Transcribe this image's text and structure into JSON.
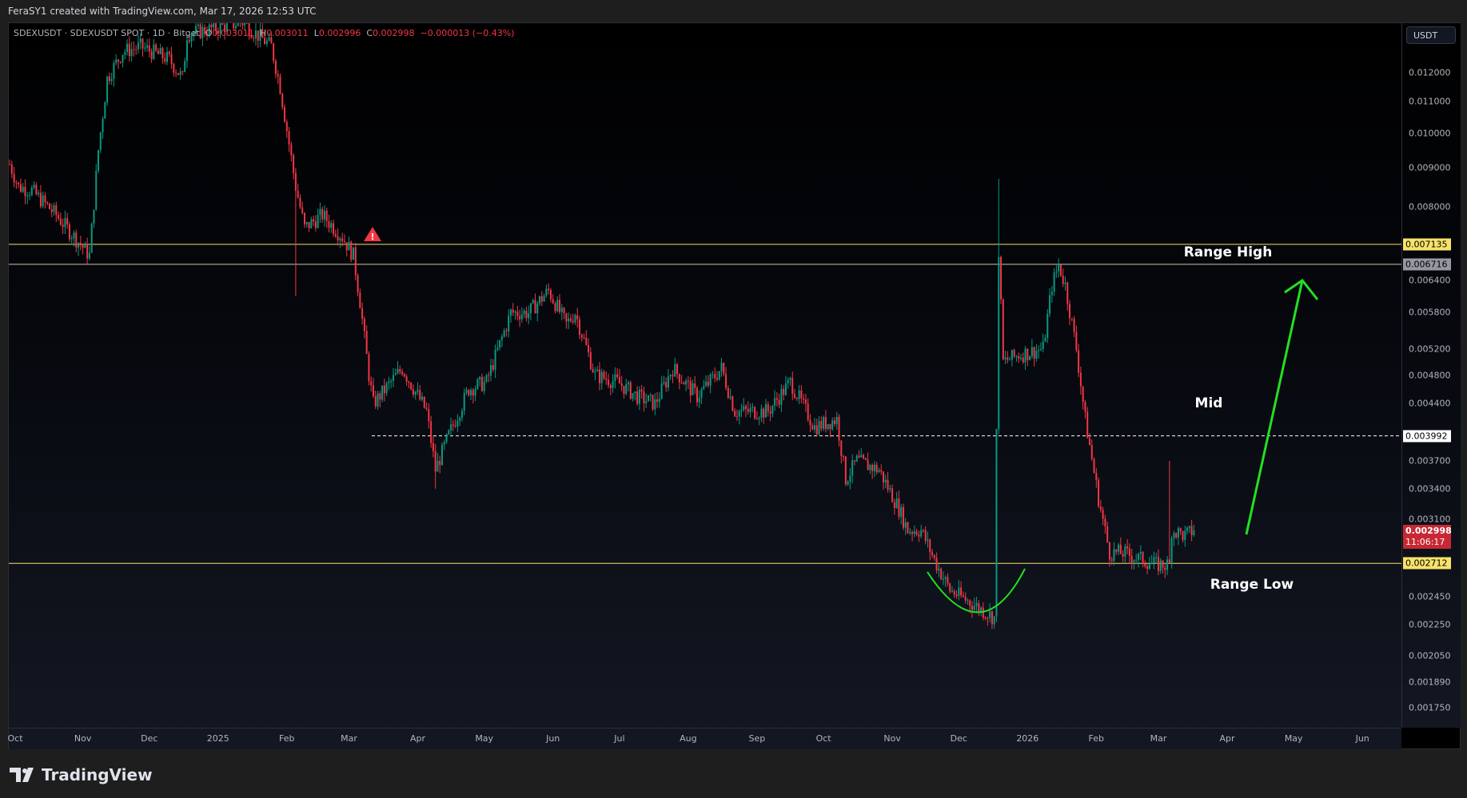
{
  "header": {
    "caption": "FeraSY1 created with TradingView.com, Mar 17, 2026 12:53 UTC"
  },
  "legend": {
    "symbol": "SDEXUSDT · SDEXUSDT SPOT · 1D · Bitget",
    "open_label": "O",
    "open": "0.003011",
    "high_label": "H",
    "high": "0.003011",
    "low_label": "L",
    "low": "0.002996",
    "close_label": "C",
    "close": "0.002998",
    "change": "−0.000013 (−0.43%)"
  },
  "price_axis": {
    "currency": "USDT",
    "ticks": [
      "0.012000",
      "0.011000",
      "0.010000",
      "0.009000",
      "0.008000",
      "0.006400",
      "0.005800",
      "0.005200",
      "0.004800",
      "0.004400",
      "0.003700",
      "0.003400",
      "0.003100",
      "0.002450",
      "0.002250",
      "0.002050",
      "0.001890",
      "0.001750"
    ],
    "labels": {
      "range_high": "0.007135",
      "upper_line": "0.006716",
      "mid": "0.003992",
      "last_price": "0.002998",
      "countdown": "11:06:17",
      "range_low": "0.002712"
    }
  },
  "time_axis": {
    "ticks": [
      {
        "label": "Oct",
        "day": 0
      },
      {
        "label": "Nov",
        "day": 31
      },
      {
        "label": "Dec",
        "day": 61
      },
      {
        "label": "2025",
        "day": 92
      },
      {
        "label": "Feb",
        "day": 123
      },
      {
        "label": "Mar",
        "day": 151
      },
      {
        "label": "Apr",
        "day": 182
      },
      {
        "label": "May",
        "day": 212
      },
      {
        "label": "Jun",
        "day": 243
      },
      {
        "label": "Jul",
        "day": 273
      },
      {
        "label": "Aug",
        "day": 304
      },
      {
        "label": "Sep",
        "day": 335
      },
      {
        "label": "Oct",
        "day": 365
      },
      {
        "label": "Nov",
        "day": 396
      },
      {
        "label": "Dec",
        "day": 426
      },
      {
        "label": "2026",
        "day": 457
      },
      {
        "label": "Feb",
        "day": 488
      },
      {
        "label": "Mar",
        "day": 516
      },
      {
        "label": "Apr",
        "day": 547
      },
      {
        "label": "May",
        "day": 577
      },
      {
        "label": "Jun",
        "day": 608
      }
    ]
  },
  "annotations": {
    "range_high": "Range High",
    "mid": "Mid",
    "range_low": "Range Low"
  },
  "colors": {
    "up": "#089981",
    "down": "#f23645",
    "level": "#f7e26b",
    "arrow": "#22e022"
  },
  "chart_data": {
    "type": "candlestick",
    "scale": "log",
    "start_date": "2024-10-01",
    "close_keypoints": [
      [
        -2,
        0.0091
      ],
      [
        2,
        0.0085
      ],
      [
        8,
        0.0084
      ],
      [
        19,
        0.0078
      ],
      [
        34,
        0.0069
      ],
      [
        38,
        0.0095
      ],
      [
        42,
        0.0118
      ],
      [
        49,
        0.0128
      ],
      [
        57,
        0.013
      ],
      [
        70,
        0.0125
      ],
      [
        76,
        0.0118
      ],
      [
        78,
        0.0135
      ],
      [
        103,
        0.014
      ],
      [
        116,
        0.013
      ],
      [
        120,
        0.0115
      ],
      [
        127,
        0.0085
      ],
      [
        131,
        0.0075
      ],
      [
        139,
        0.0078
      ],
      [
        148,
        0.0073
      ],
      [
        153,
        0.0069
      ],
      [
        156,
        0.006
      ],
      [
        160,
        0.0048
      ],
      [
        162,
        0.0044
      ],
      [
        175,
        0.0049
      ],
      [
        186,
        0.0043
      ],
      [
        190,
        0.0036
      ],
      [
        196,
        0.004
      ],
      [
        205,
        0.0046
      ],
      [
        213,
        0.0047
      ],
      [
        224,
        0.0058
      ],
      [
        232,
        0.0058
      ],
      [
        241,
        0.0062
      ],
      [
        249,
        0.0056
      ],
      [
        253,
        0.0058
      ],
      [
        262,
        0.0048
      ],
      [
        272,
        0.0047
      ],
      [
        281,
        0.0045
      ],
      [
        289,
        0.0044
      ],
      [
        297,
        0.0049
      ],
      [
        308,
        0.0045
      ],
      [
        319,
        0.0049
      ],
      [
        325,
        0.0043
      ],
      [
        340,
        0.0043
      ],
      [
        350,
        0.0047
      ],
      [
        361,
        0.0041
      ],
      [
        371,
        0.0042
      ],
      [
        375,
        0.0035
      ],
      [
        380,
        0.0037
      ],
      [
        390,
        0.0036
      ],
      [
        399,
        0.0032
      ],
      [
        403,
        0.003
      ],
      [
        409,
        0.003
      ],
      [
        416,
        0.0027
      ],
      [
        422,
        0.0025
      ],
      [
        432,
        0.0024
      ],
      [
        442,
        0.0023
      ],
      [
        444,
        0.007
      ],
      [
        446,
        0.005
      ],
      [
        453,
        0.0051
      ],
      [
        464,
        0.0052
      ],
      [
        468,
        0.0063
      ],
      [
        471,
        0.0067
      ],
      [
        474,
        0.0063
      ],
      [
        479,
        0.0052
      ],
      [
        483,
        0.0042
      ],
      [
        489,
        0.0033
      ],
      [
        494,
        0.0028
      ],
      [
        500,
        0.0028
      ],
      [
        515,
        0.0027
      ],
      [
        521,
        0.0027
      ],
      [
        522,
        0.003
      ],
      [
        528,
        0.00295
      ],
      [
        532,
        0.002998
      ]
    ],
    "spike_highs": [
      [
        444,
        0.0087
      ],
      [
        521,
        0.0037
      ],
      [
        127,
        0.0061
      ],
      [
        190,
        0.0034
      ]
    ],
    "levels": {
      "range_high": 0.007135,
      "upper": 0.006716,
      "mid": 0.003992,
      "range_low": 0.002712
    }
  },
  "footer": {
    "brand": "TradingView"
  }
}
